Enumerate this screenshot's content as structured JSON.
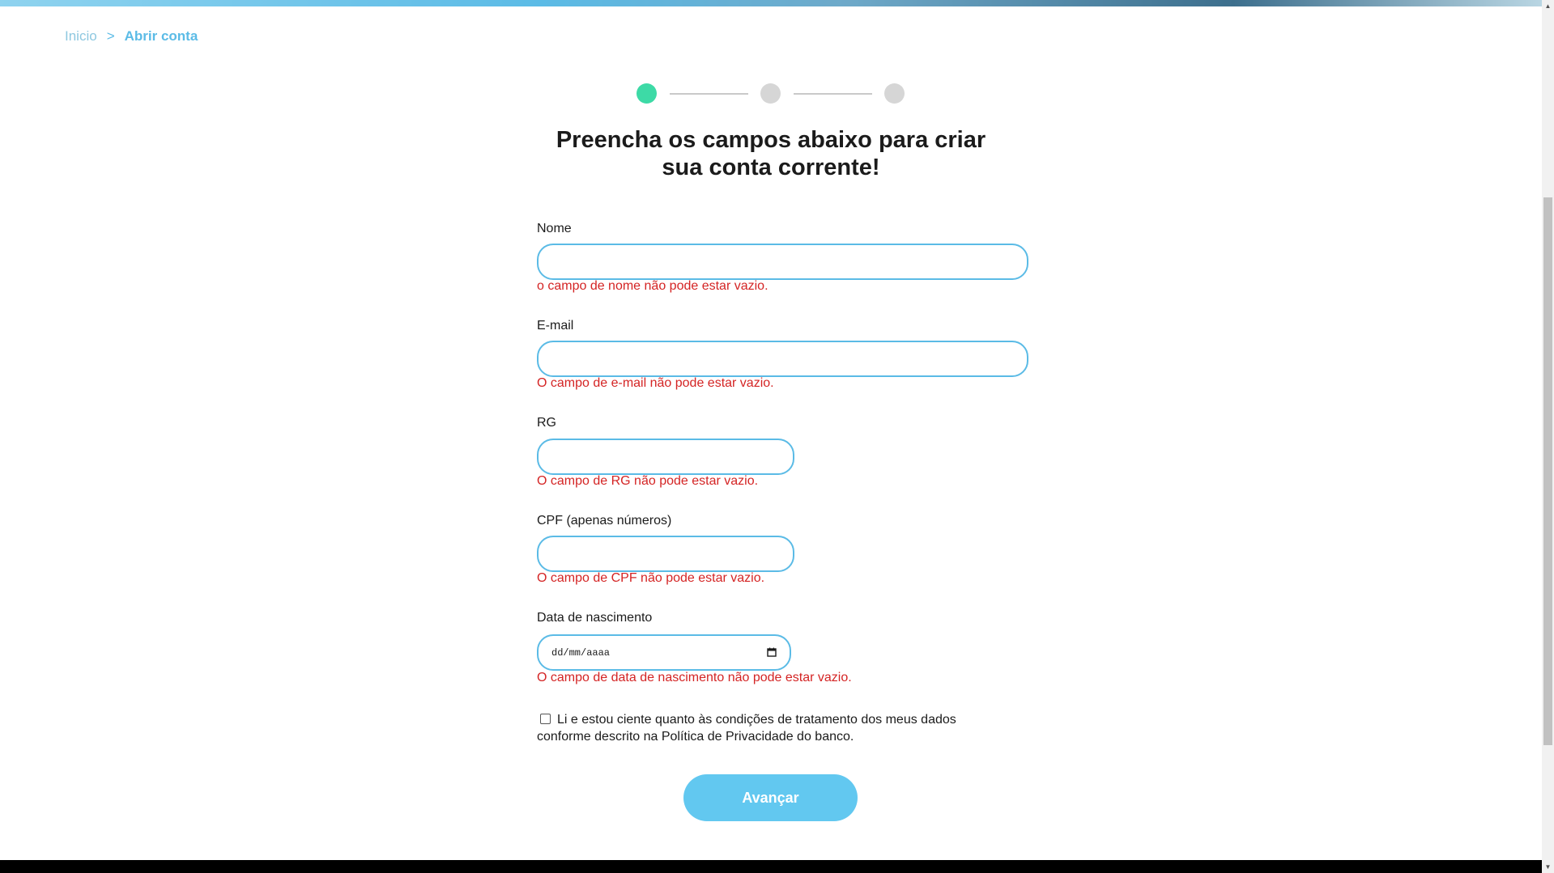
{
  "breadcrumb": {
    "home": "Inicio",
    "separator": ">",
    "current": "Abrir conta"
  },
  "stepper": {
    "total_steps": 3,
    "current_step": 1
  },
  "form": {
    "title_line1": "Preencha os campos abaixo para criar",
    "title_line2": "sua conta corrente!",
    "fields": {
      "nome": {
        "label": "Nome",
        "value": "",
        "error": "o campo de nome não pode estar vazio."
      },
      "email": {
        "label": "E-mail",
        "value": "",
        "error": "O campo de e-mail não pode estar vazio."
      },
      "rg": {
        "label": "RG",
        "value": "",
        "error": "O campo de RG não pode estar vazio."
      },
      "cpf": {
        "label": "CPF (apenas números)",
        "value": "",
        "error": "O campo de CPF não pode estar vazio."
      },
      "nascimento": {
        "label": "Data de nascimento",
        "placeholder": "dd/mm/aaaa",
        "error": "O campo de data de nascimento não pode estar vazio."
      }
    },
    "consent": {
      "checked": false,
      "text": "Li e estou ciente quanto às condições de tratamento dos meus dados conforme descrito na Política de Privacidade do banco."
    },
    "submit_label": "Avançar"
  },
  "colors": {
    "accent": "#5bbbe6",
    "button": "#62c8f0",
    "step_active": "#3ddaa6",
    "step_inactive": "#d6d6d6",
    "error": "#d42424"
  }
}
